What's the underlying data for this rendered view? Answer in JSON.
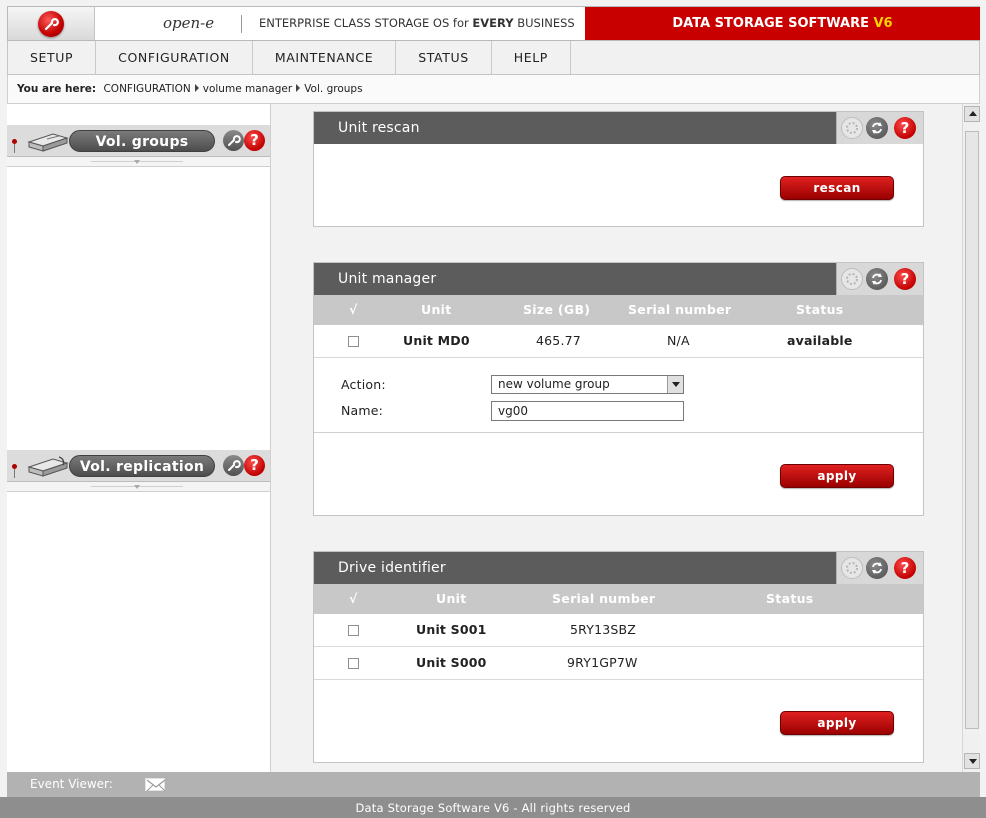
{
  "header": {
    "brand": "open-e",
    "tagline_prefix": "ENTERPRISE CLASS STORAGE OS for",
    "tagline_bold": "EVERY",
    "tagline_suffix": "BUSINESS",
    "product_prefix": "DATA STORAGE SOFTWARE",
    "product_version": "V6",
    "accent_color": "#c80000"
  },
  "menu": [
    "SETUP",
    "CONFIGURATION",
    "MAINTENANCE",
    "STATUS",
    "HELP"
  ],
  "breadcrumb": {
    "label": "You are here:",
    "items": [
      "CONFIGURATION",
      "volume manager",
      "Vol. groups"
    ]
  },
  "left_panel": {
    "sections": [
      {
        "title": "Vol. groups",
        "icon": "drive-icon"
      },
      {
        "title": "Vol. replication",
        "icon": "drive-replication-icon"
      }
    ]
  },
  "unit_rescan": {
    "title": "Unit rescan",
    "button": "rescan"
  },
  "unit_manager": {
    "title": "Unit manager",
    "columns": [
      "√",
      "Unit",
      "Size (GB)",
      "Serial number",
      "Status"
    ],
    "rows": [
      {
        "unit": "Unit MD0",
        "size": "465.77",
        "serial": "N/A",
        "status": "available"
      }
    ],
    "action_label": "Action:",
    "action_value": "new volume group",
    "name_label": "Name:",
    "name_value": "vg00",
    "button": "apply"
  },
  "drive_identifier": {
    "title": "Drive identifier",
    "columns": [
      "√",
      "Unit",
      "Serial number",
      "Status"
    ],
    "rows": [
      {
        "unit": "Unit S001",
        "serial": "5RY13SBZ",
        "status": ""
      },
      {
        "unit": "Unit S000",
        "serial": "9RY1GP7W",
        "status": ""
      }
    ],
    "button": "apply"
  },
  "event_viewer": {
    "label": "Event Viewer:"
  },
  "footer": {
    "text": "Data Storage Software V6 - All rights reserved"
  }
}
